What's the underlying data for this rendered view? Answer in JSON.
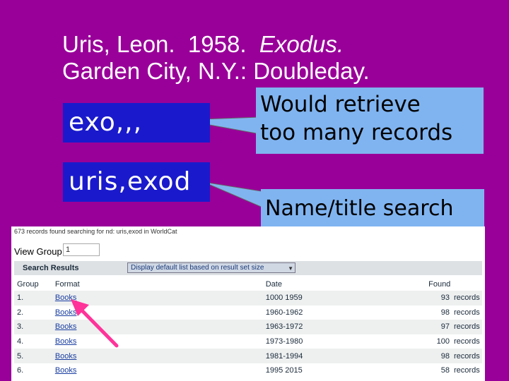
{
  "citation": {
    "line1_prefix": "Uris, Leon.  1958.  ",
    "line1_title": "Exodus.",
    "line2": "Garden City, N.Y.: Doubleday."
  },
  "search_keys": {
    "key1": "exo,,,",
    "key2": "uris,exod"
  },
  "callouts": {
    "first_line1": "Would retrieve",
    "first_line2": "too many records",
    "second": "Name/title search"
  },
  "screenshot": {
    "header": "673 records found searching for nd: uris,exod in WorldCat",
    "view_group_label": "View Group",
    "view_group_value": "1",
    "results_title": "Search Results",
    "display_select": "Display default list based on result set size",
    "columns": [
      "Group",
      "Format",
      "Date",
      "Found"
    ],
    "rows": [
      {
        "group": "1.",
        "format": "Books",
        "date": "1000 1959",
        "count": "93",
        "unit": "records"
      },
      {
        "group": "2.",
        "format": "Books",
        "date": "1960-1962",
        "count": "98",
        "unit": "records"
      },
      {
        "group": "3.",
        "format": "Books",
        "date": "1963-1972",
        "count": "97",
        "unit": "records"
      },
      {
        "group": "4.",
        "format": "Books",
        "date": "1973-1980",
        "count": "100",
        "unit": "records"
      },
      {
        "group": "5.",
        "format": "Books",
        "date": "1981-1994",
        "count": "98",
        "unit": "records"
      },
      {
        "group": "6.",
        "format": "Books",
        "date": "1995 2015",
        "count": "58",
        "unit": "records"
      }
    ]
  },
  "colors": {
    "background": "#990099",
    "search_box": "#1a1acc",
    "callout": "#80b4f0",
    "arrow": "#ff3399"
  }
}
